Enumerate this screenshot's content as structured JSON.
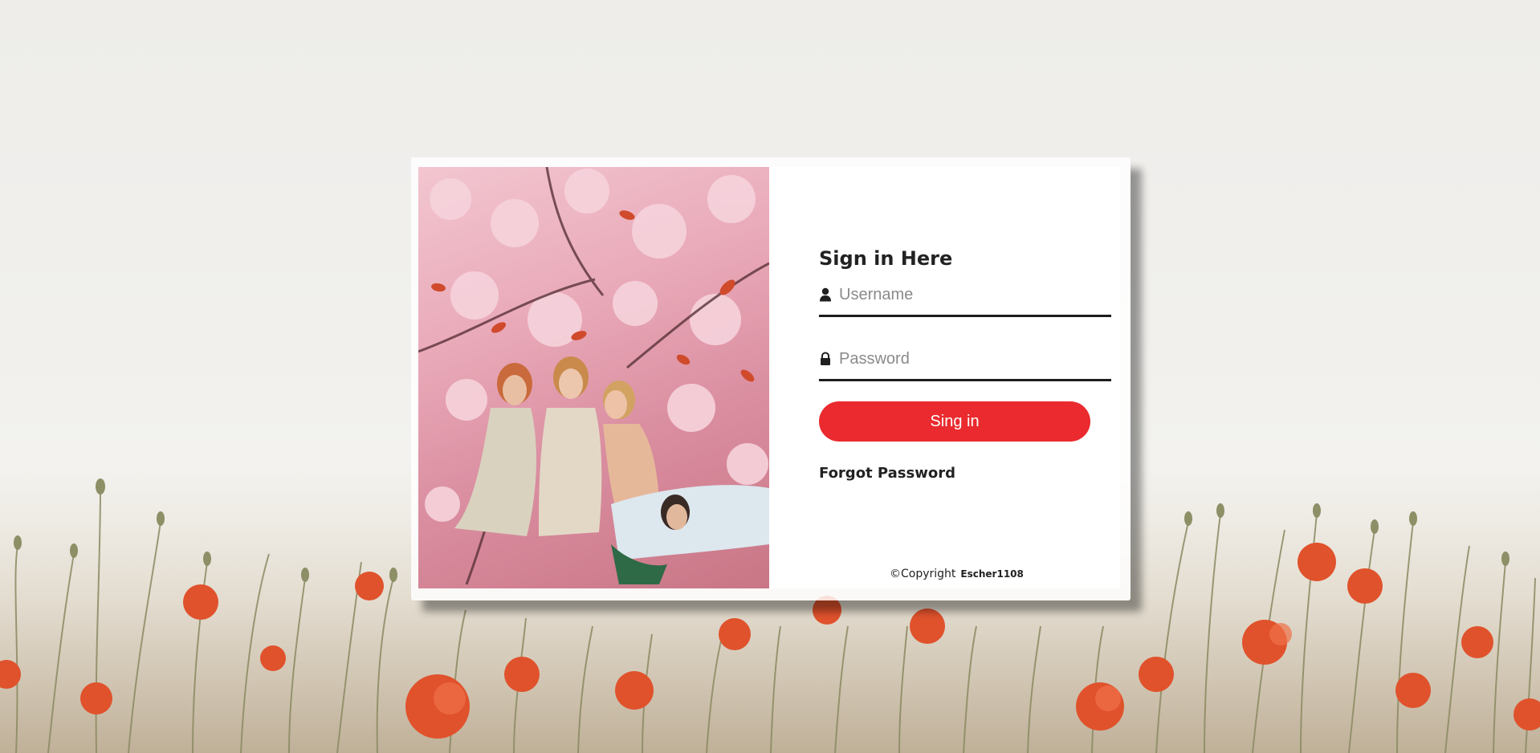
{
  "form": {
    "title": "Sign in Here",
    "username_placeholder": "Username",
    "password_placeholder": "Password",
    "signin_label": "Sing in",
    "forgot_label": "Forgot Password"
  },
  "footer": {
    "copyright_label": "©Copyright",
    "owner": "Escher1108"
  },
  "icons": {
    "username": "user-icon",
    "password": "lock-icon"
  },
  "colors": {
    "accent": "#ea2a2e",
    "underline": "#1d1d1d",
    "card": "#ffffff"
  }
}
